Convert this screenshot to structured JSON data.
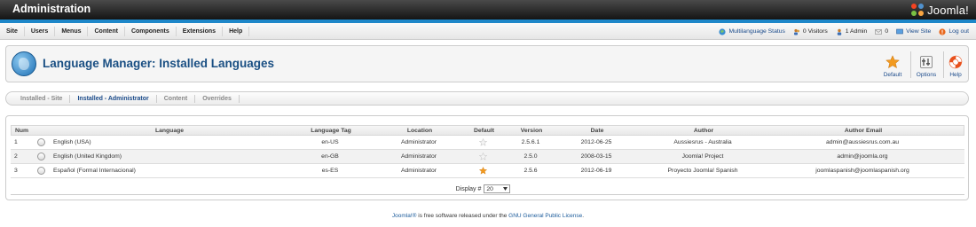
{
  "header": {
    "title": "Administration",
    "logo_text": "Joomla!"
  },
  "menu": [
    "Site",
    "Users",
    "Menus",
    "Content",
    "Components",
    "Extensions",
    "Help"
  ],
  "status": {
    "multilanguage": "Multilanguage Status",
    "visitors": "0 Visitors",
    "admins": "1 Admin",
    "messages": "0",
    "view_site": "View Site",
    "logout": "Log out"
  },
  "toolbar": {
    "page_title": "Language Manager: Installed Languages",
    "default_label": "Default",
    "options_label": "Options",
    "help_label": "Help"
  },
  "subnav": [
    "Installed - Site",
    "Installed - Administrator",
    "Content",
    "Overrides"
  ],
  "table": {
    "headers": [
      "Num",
      "Language",
      "Language Tag",
      "Location",
      "Default",
      "Version",
      "Date",
      "Author",
      "Author Email"
    ],
    "rows": [
      {
        "num": "1",
        "language": "English (USA)",
        "tag": "en-US",
        "location": "Administrator",
        "is_default": false,
        "version": "2.5.6.1",
        "date": "2012-06-25",
        "author": "Aussiesrus - Australia",
        "email": "admin@aussiesrus.com.au"
      },
      {
        "num": "2",
        "language": "English (United Kingdom)",
        "tag": "en-GB",
        "location": "Administrator",
        "is_default": false,
        "version": "2.5.0",
        "date": "2008-03-15",
        "author": "Joomla! Project",
        "email": "admin@joomla.org"
      },
      {
        "num": "3",
        "language": "Español (Formal Internacional)",
        "tag": "es-ES",
        "location": "Administrator",
        "is_default": true,
        "version": "2.5.6",
        "date": "2012-06-19",
        "author": "Proyecto Joomla! Spanish",
        "email": "joomlaspanish@joomlaspanish.org"
      }
    ],
    "display_label": "Display #",
    "display_value": "20"
  },
  "footer": {
    "prefix": "Joomla!®",
    "middle": " is free software released under the ",
    "license": "GNU General Public License",
    "suffix": "."
  },
  "colors": {
    "accent": "#1e87c9",
    "title": "#1a4f83",
    "star_active": "#f29a1f"
  }
}
